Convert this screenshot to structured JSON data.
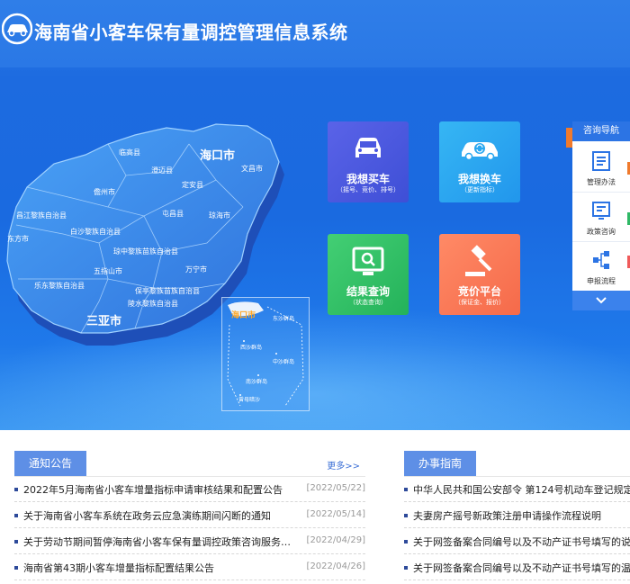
{
  "header": {
    "title": "海南省小客车保有量调控管理信息系统"
  },
  "map": {
    "labels": [
      {
        "name": "海口市",
        "big": true
      },
      {
        "name": "临高县"
      },
      {
        "name": "澄迈县"
      },
      {
        "name": "定安县"
      },
      {
        "name": "文昌市"
      },
      {
        "name": "儋州市"
      },
      {
        "name": "屯昌县"
      },
      {
        "name": "琼海市"
      },
      {
        "name": "昌江黎族自治县"
      },
      {
        "name": "白沙黎族自治县"
      },
      {
        "name": "东方市"
      },
      {
        "name": "琼中黎族苗族自治县"
      },
      {
        "name": "五指山市"
      },
      {
        "name": "万宁市"
      },
      {
        "name": "乐东黎族自治县"
      },
      {
        "name": "保亭黎族苗族自治县"
      },
      {
        "name": "陵水黎族自治县"
      },
      {
        "name": "三亚市",
        "big": true
      }
    ],
    "inset_labels": [
      "海口市",
      "东沙群岛",
      "西沙群岛",
      "中沙群岛",
      "南沙群岛",
      "曾母暗沙"
    ]
  },
  "tiles": {
    "buy": {
      "title": "我想买车",
      "sub": "（摇号、竞价、排号）"
    },
    "change": {
      "title": "我想换车",
      "sub": "（更新指标）"
    },
    "result": {
      "title": "结果查询",
      "sub": "（状态查询）"
    },
    "bid": {
      "title": "竞价平台",
      "sub": "（保证金、报价）"
    }
  },
  "nav_panel": {
    "title": "咨询导航",
    "items": [
      "管理办法",
      "政策咨询",
      "申报流程"
    ]
  },
  "notices": {
    "title": "通知公告",
    "more": "更多>>",
    "items": [
      {
        "title": "2022年5月海南省小客车增量指标申请审核结果和配置公告",
        "date": "[2022/05/22]"
      },
      {
        "title": "关于海南省小客车系统在政务云应急演练期间闪断的通知",
        "date": "[2022/05/14]"
      },
      {
        "title": "关于劳动节期间暂停海南省小客车保有量调控政策咨询服务…",
        "date": "[2022/04/29]"
      },
      {
        "title": "海南省第43期小客车增量指标配置结果公告",
        "date": "[2022/04/26]"
      }
    ]
  },
  "guide": {
    "title": "办事指南",
    "items": [
      {
        "title": "中华人民共和国公安部令 第124号机动车登记规定"
      },
      {
        "title": "夫妻房产摇号新政策注册申请操作流程说明"
      },
      {
        "title": "关于网签备案合同编号以及不动产证书号填写的说明"
      },
      {
        "title": "关于网签备案合同编号以及不动产证书号填写的温馨提示"
      }
    ]
  },
  "colors": {
    "primary": "#2c74e4",
    "tab": "#5e8fe6",
    "accent": "#f07a2c"
  }
}
